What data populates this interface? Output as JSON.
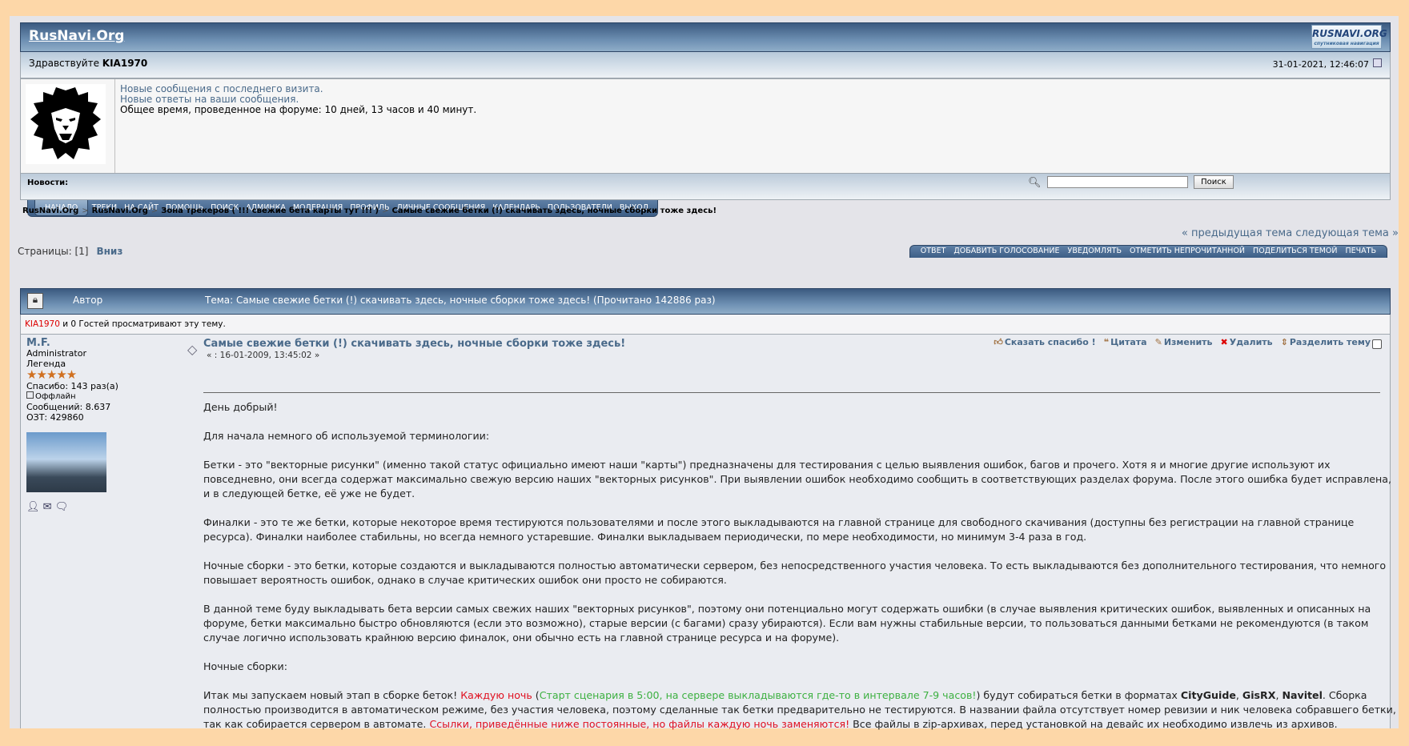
{
  "header": {
    "site_title": "RusNavi.Org",
    "logo_text": "RUSNAVI.ORG",
    "logo_sub": "спутниковая навигация"
  },
  "greeting": {
    "prefix": "Здравствуйте",
    "user": "KIA1970",
    "datetime": "31-01-2021, 12:46:07"
  },
  "info": {
    "new_messages": "Новые сообщения с последнего визита.",
    "new_replies": "Новые ответы на ваши сообщения.",
    "time_on_forum": "Общее время, проведенное на форуме: 10 дней, 13 часов и 40 минут."
  },
  "news": {
    "label": "Новости:",
    "search_value": "",
    "search_button": "Поиск"
  },
  "nav": [
    "НАЧАЛО",
    "ТРЕКИ",
    "НА САЙТ",
    "ПОМОЩЬ",
    "ПОИСК",
    "АДМИНКА",
    "МОДЕРАЦИЯ",
    "ПРОФИЛЬ",
    "ЛИЧНЫЕ СООБЩЕНИЯ",
    "КАЛЕНДАРЬ",
    "ПОЛЬЗОВАТЕЛИ",
    "ВЫХОД"
  ],
  "breadcrumb": [
    "RusNavi.Org",
    "RusNavi.Org",
    "Зона трекеров ( !!! свежие бета карты тут !!! )",
    "Самые свежие бетки (!) скачивать здесь, ночные сборки тоже здесь!"
  ],
  "breadcrumb_sep": ">",
  "prevnext": "« предыдущая тема следующая тема »",
  "pages": {
    "label": "Страницы: [1]",
    "down": "Вниз"
  },
  "actions": [
    "ОТВЕТ",
    "ДОБАВИТЬ ГОЛОСОВАНИЕ",
    "УВЕДОМЛЯТЬ",
    "ОТМЕТИТЬ НЕПРОЧИТАННОЙ",
    "ПОДЕЛИТЬСЯ ТЕМОЙ",
    "ПЕЧАТЬ"
  ],
  "thread_header": {
    "author": "Автор",
    "topic": "Тема: Самые свежие бетки (!) скачивать здесь, ночные сборки тоже здесь!  (Прочитано 142886 раз)"
  },
  "viewers": {
    "user": "KIA1970",
    "text": " и 0 Гостей просматривают эту тему."
  },
  "author": {
    "name": "M.F.",
    "group": "Administrator",
    "rank": "Легенда",
    "stars": "★★★★★",
    "thanks": "Спасибо: 143 раз(а)",
    "status": "Оффлайн",
    "posts": "Сообщений: 8.637",
    "ozt": "ОЗТ: 429860"
  },
  "post": {
    "title": "Самые свежие бетки (!) скачивать здесь, ночные сборки тоже здесь!",
    "date": "« : 16-01-2009, 13:45:02 »",
    "buttons": [
      "Сказать спасибо !",
      "Цитата",
      "Изменить",
      "Удалить",
      "Разделить тему"
    ],
    "paragraphs": [
      "День добрый!",
      "Для начала немного об используемой терминологии:",
      "Бетки - это \"векторные рисунки\" (именно такой статус официально имеют наши \"карты\") предназначены для тестирования с целью выявления ошибок, багов и прочего. Хотя я и многие другие используют их повседневно, они всегда содержат максимально свежую версию наших \"векторных рисунков\". При выявлении ошибок необходимо сообщить в соответствующих разделах форума. После этого ошибка будет исправлена, и в следующей бетке, её уже не будет.",
      "Финалки - это те же бетки, которые некоторое время тестируются пользователями и после этого выкладываются на главной странице для свободного скачивания (доступны без регистрации на главной странице ресурса). Финалки наиболее стабильны, но всегда немного устаревшие. Финалки выкладываем периодически, по мере необходимости, но минимум 3-4 раза в год.",
      "Ночные сборки - это бетки, которые создаются и выкладываются полностью автоматически сервером, без непосредственного участия человека. То есть выкладываются без дополнительного тестирования, что немного повышает вероятность ошибок, однако в случае критических ошибок они просто не собираются.",
      "В данной теме буду выкладывать бета версии самых свежих наших \"векторных рисунков\", поэтому они потенциально могут содержать ошибки (в случае выявления критических ошибок, выявленных и описанных на форуме, бетки максимально быстро обновляются (если это возможно), старые версии (с багами) сразу убираются). Если вам нужны стабильные версии, то пользоваться данными бетками не рекомендуются (в таком случае логично использовать крайнюю версию финалок, они обычно есть на главной странице ресурса и на форуме).",
      "Ночные сборки:"
    ],
    "last_paragraph": [
      {
        "text": "Итак мы запускаем новый этап в сборке беток! ",
        "style": "normal"
      },
      {
        "text": "Каждую ночь",
        "style": "red"
      },
      {
        "text": " (",
        "style": "normal"
      },
      {
        "text": "Старт сценария в 5:00, на сервере выкладываются где-то в интервале 7-9 часов!",
        "style": "green"
      },
      {
        "text": ") будут собираться бетки в форматах ",
        "style": "normal"
      },
      {
        "text": "CityGuide",
        "style": "b"
      },
      {
        "text": ", ",
        "style": "normal"
      },
      {
        "text": "GisRX",
        "style": "b"
      },
      {
        "text": ", ",
        "style": "normal"
      },
      {
        "text": "Navitel",
        "style": "b"
      },
      {
        "text": ". Сборка полностью производится в автоматическом режиме, без участия человека, поэтому сделанные так бетки предварительно не тестируются. В названии файла отсутствует номер ревизии и ник человека собравшего бетки, так как собирается сервером в автомате. ",
        "style": "normal"
      },
      {
        "text": "Ссылки, приведённые ниже постоянные, но файлы каждую ночь заменяются!",
        "style": "red"
      },
      {
        "text": " Все файлы в zip-архивах, перед установкой на девайс их необходимо извлечь из архивов.",
        "style": "normal"
      }
    ]
  },
  "colors": {
    "background": "#fdd7a8",
    "page": "#e4e4e9",
    "header": "#3b5a80",
    "link": "#4a6a8a",
    "red": "#e01020",
    "green": "#3cb040"
  }
}
